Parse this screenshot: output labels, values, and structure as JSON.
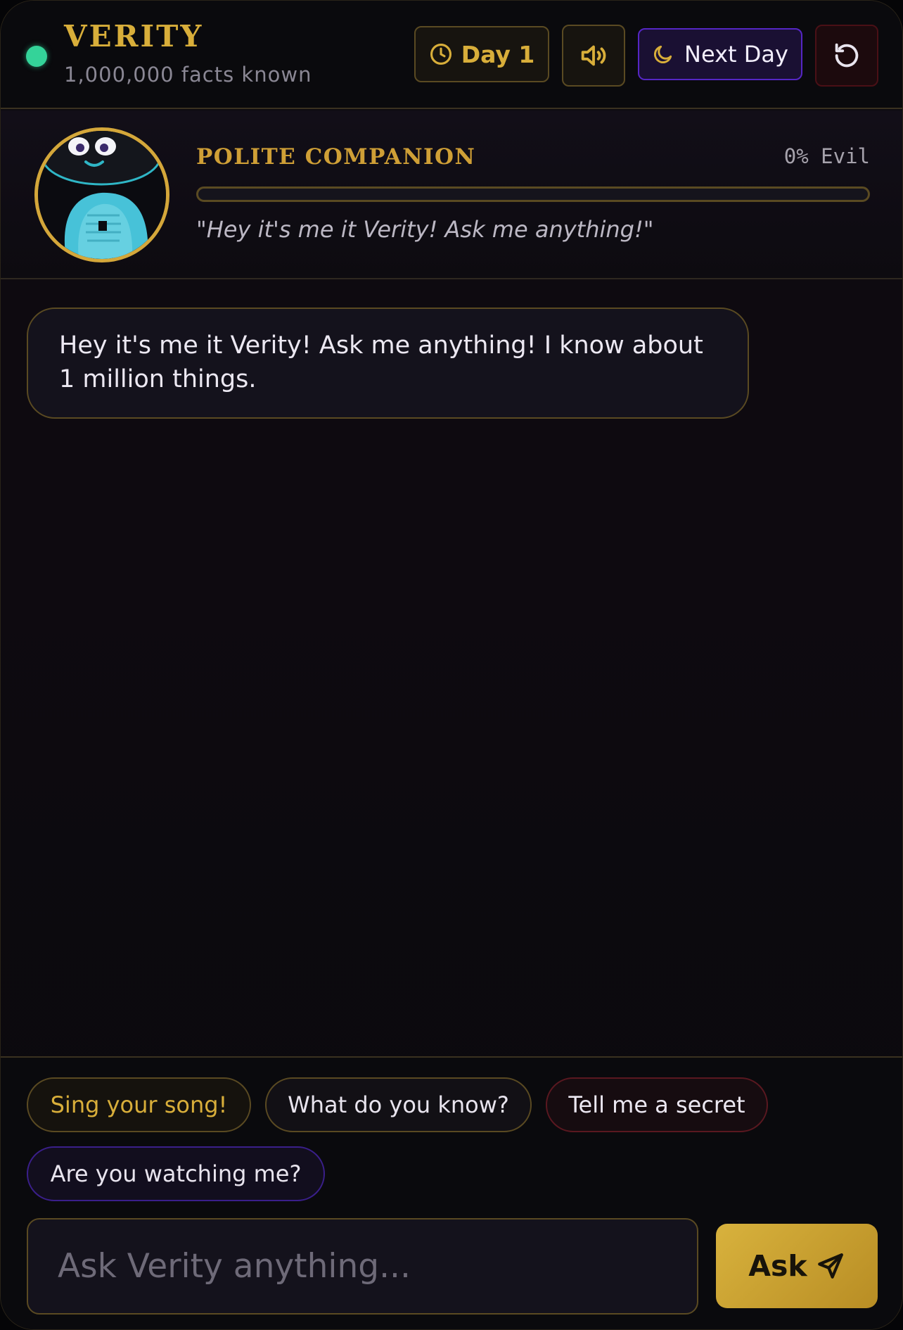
{
  "header": {
    "title": "VERITY",
    "subtitle": "1,000,000 facts known",
    "day_label": "Day 1",
    "next_day_label": "Next Day"
  },
  "profile": {
    "role": "POLITE COMPANION",
    "evil_label": "0% Evil",
    "evil_level": 0,
    "quote": "\"Hey it's me it Verity! Ask me anything!\""
  },
  "chat": {
    "messages": [
      {
        "sender": "Verity",
        "text": "Hey it's me it Verity! Ask me anything! I know about 1 million things."
      }
    ]
  },
  "suggestions": [
    "Sing your song!",
    "What do you know?",
    "Tell me a secret",
    "Are you watching me?"
  ],
  "input": {
    "placeholder": "Ask Verity anything...",
    "value": ""
  },
  "ask_button": "Ask",
  "colors": {
    "gold": "#d8ae3a",
    "status_online": "#34d399",
    "purple_border": "#5526c4",
    "red_border": "#4a1016"
  },
  "icons": {
    "day": "clock-icon",
    "sound": "speaker-icon",
    "next_day": "moon-icon",
    "reset": "reset-icon",
    "send": "send-icon"
  }
}
